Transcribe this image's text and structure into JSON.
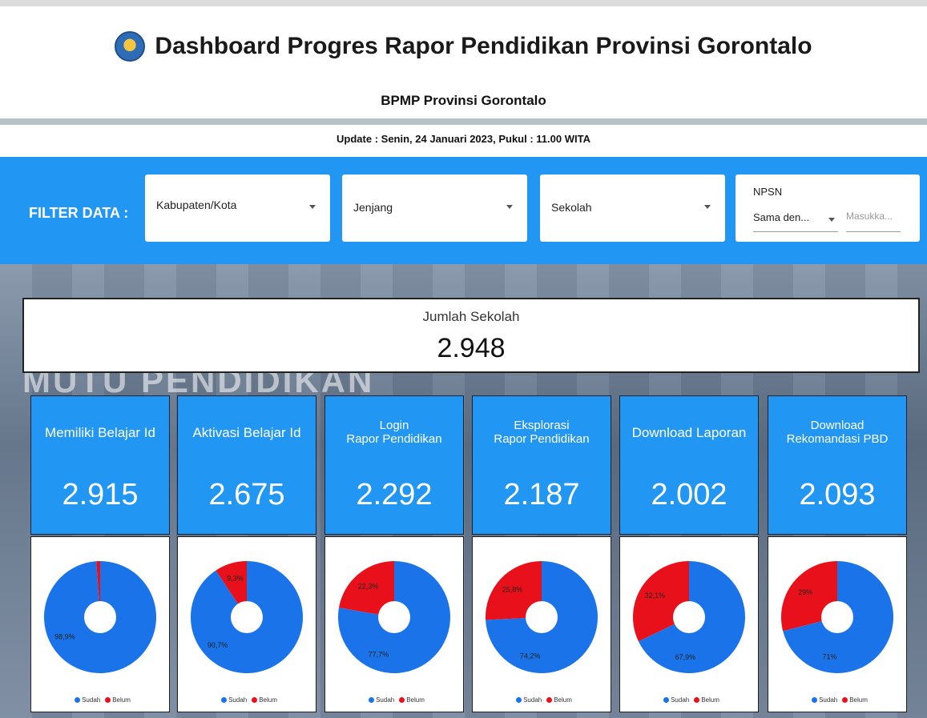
{
  "header": {
    "title": "Dashboard Progres Rapor Pendidikan Provinsi Gorontalo",
    "subtitle": "BPMP Provinsi Gorontalo",
    "update": "Update : Senin, 24 Januari 2023, Pukul : 11.00 WITA"
  },
  "background_text": "MUTU PENDIDIKAN",
  "filters": {
    "label": "FILTER DATA :",
    "kabupaten": "Kabupaten/Kota",
    "jenjang": "Jenjang",
    "sekolah": "Sekolah",
    "npsn_label": "NPSN",
    "npsn_operator": "Sama den...",
    "npsn_placeholder": "Masukka..."
  },
  "total": {
    "label": "Jumlah Sekolah",
    "value": "2.948"
  },
  "cards": [
    {
      "title": "Memiliki Belajar Id",
      "value": "2.915",
      "sudah": 98.9,
      "belum": 1.1,
      "sudah_label": "98,9%",
      "belum_label": ""
    },
    {
      "title": "Aktivasi Belajar Id",
      "value": "2.675",
      "sudah": 90.7,
      "belum": 9.3,
      "sudah_label": "90,7%",
      "belum_label": "9,3%"
    },
    {
      "title": "Login\nRapor Pendidikan",
      "value": "2.292",
      "sudah": 77.7,
      "belum": 22.3,
      "sudah_label": "77,7%",
      "belum_label": "22,3%"
    },
    {
      "title": "Eksplorasi\nRapor Pendidikan",
      "value": "2.187",
      "sudah": 74.2,
      "belum": 25.8,
      "sudah_label": "74,2%",
      "belum_label": "25,8%"
    },
    {
      "title": "Download Laporan",
      "value": "2.002",
      "sudah": 67.9,
      "belum": 32.1,
      "sudah_label": "67,9%",
      "belum_label": "32,1%"
    },
    {
      "title": "Download\nRekomandasi PBD",
      "value": "2.093",
      "sudah": 71,
      "belum": 29,
      "sudah_label": "71%",
      "belum_label": "29%"
    }
  ],
  "legend": {
    "sudah": "Sudah",
    "belum": "Belum"
  },
  "colors": {
    "sudah": "#1a73e8",
    "belum": "#e8101a",
    "accent": "#2196f3"
  }
}
